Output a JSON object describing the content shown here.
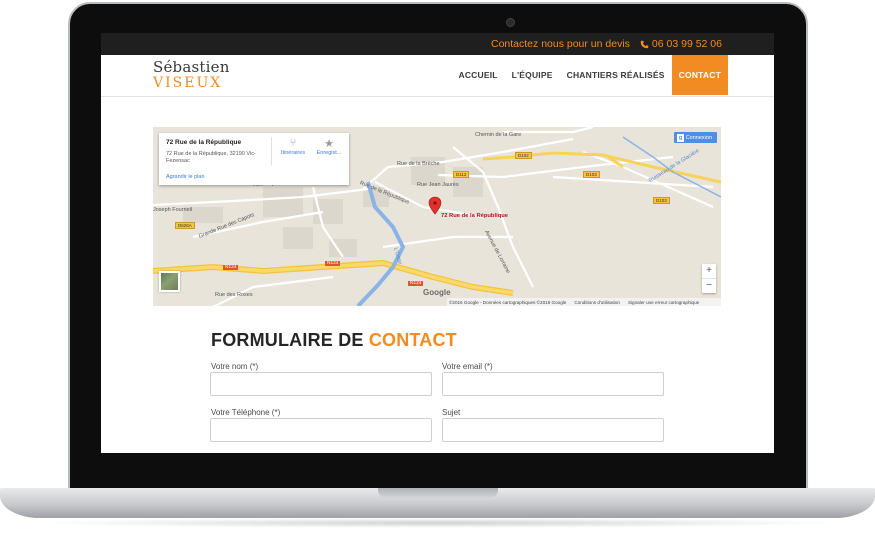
{
  "topbar": {
    "cta_text": "Contactez nous pour un devis",
    "phone": "06 03 99 52 06",
    "phone_icon": "phone-icon"
  },
  "logo": {
    "line1": "Sébastien",
    "line2": "VISEUX"
  },
  "nav": {
    "items": [
      {
        "label": "ACCUEIL"
      },
      {
        "label": "L'ÉQUIPE"
      },
      {
        "label": "CHANTIERS RÉALISÉS"
      },
      {
        "label": "CONTACT",
        "active": true
      }
    ]
  },
  "map": {
    "card": {
      "title": "72 Rue de la République",
      "address": "72 Rue de la République, 32190 Vic-Fezensac",
      "directions_label": "Itinéraires",
      "save_label": "Enregist...",
      "enlarge_link": "Agrandir le plan"
    },
    "connect_label": "Connexion",
    "pin_label": "72 Rue de la République",
    "labels": {
      "chemin": "Chemin de la Gare",
      "breche": "Rue de la Brèche",
      "jaures": "Rue Jean Jaurès",
      "raynal": "Rue Raynal",
      "republique": "Rue de la République",
      "fourneil": "Joseph Fourneil",
      "capots": "Grande Rue des Capots",
      "roses": "Rue des Roses",
      "lorraine": "Avenue de Lorraine",
      "osse": "L'Osse",
      "ruisseau": "Ruisseau de la Glacière"
    },
    "badges": {
      "d102": "D102",
      "d112": "D112",
      "d103a": "D103",
      "d103b": "D103",
      "d626": "D626A",
      "n124a": "N124",
      "n124b": "N124",
      "n124c": "N124"
    },
    "google": "Google",
    "attribution": {
      "data": "©2016 Google - Données cartographiques ©2016 Google",
      "terms": "Conditions d'utilisation",
      "report": "Signaler une erreur cartographique"
    },
    "zoom_in": "+",
    "zoom_out": "−"
  },
  "form": {
    "title_main": "FORMULAIRE DE",
    "title_accent": "CONTACT",
    "name_label": "Votre nom (*)",
    "email_label": "Votre email (*)",
    "phone_label": "Votre Téléphone (*)",
    "subject_label": "Sujet",
    "name_value": "",
    "email_value": "",
    "phone_value": "",
    "subject_value": ""
  },
  "colors": {
    "accent": "#f28b21",
    "topbar_bg": "#1f1f1f"
  }
}
